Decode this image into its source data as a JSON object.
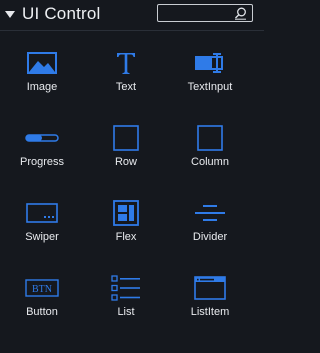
{
  "panel": {
    "title": "UI Control",
    "search": {
      "value": "",
      "placeholder": ""
    },
    "accent_color": "#2f7be8"
  },
  "components": [
    {
      "label": "Image",
      "icon": "image-icon"
    },
    {
      "label": "Text",
      "icon": "text-icon"
    },
    {
      "label": "TextInput",
      "icon": "textinput-icon"
    },
    {
      "label": "Progress",
      "icon": "progress-icon"
    },
    {
      "label": "Row",
      "icon": "row-icon"
    },
    {
      "label": "Column",
      "icon": "column-icon"
    },
    {
      "label": "Swiper",
      "icon": "swiper-icon"
    },
    {
      "label": "Flex",
      "icon": "flex-icon"
    },
    {
      "label": "Divider",
      "icon": "divider-icon"
    },
    {
      "label": "Button",
      "icon": "button-icon"
    },
    {
      "label": "List",
      "icon": "list-icon"
    },
    {
      "label": "ListItem",
      "icon": "listitem-icon"
    }
  ],
  "button_icon_text": "BTN"
}
